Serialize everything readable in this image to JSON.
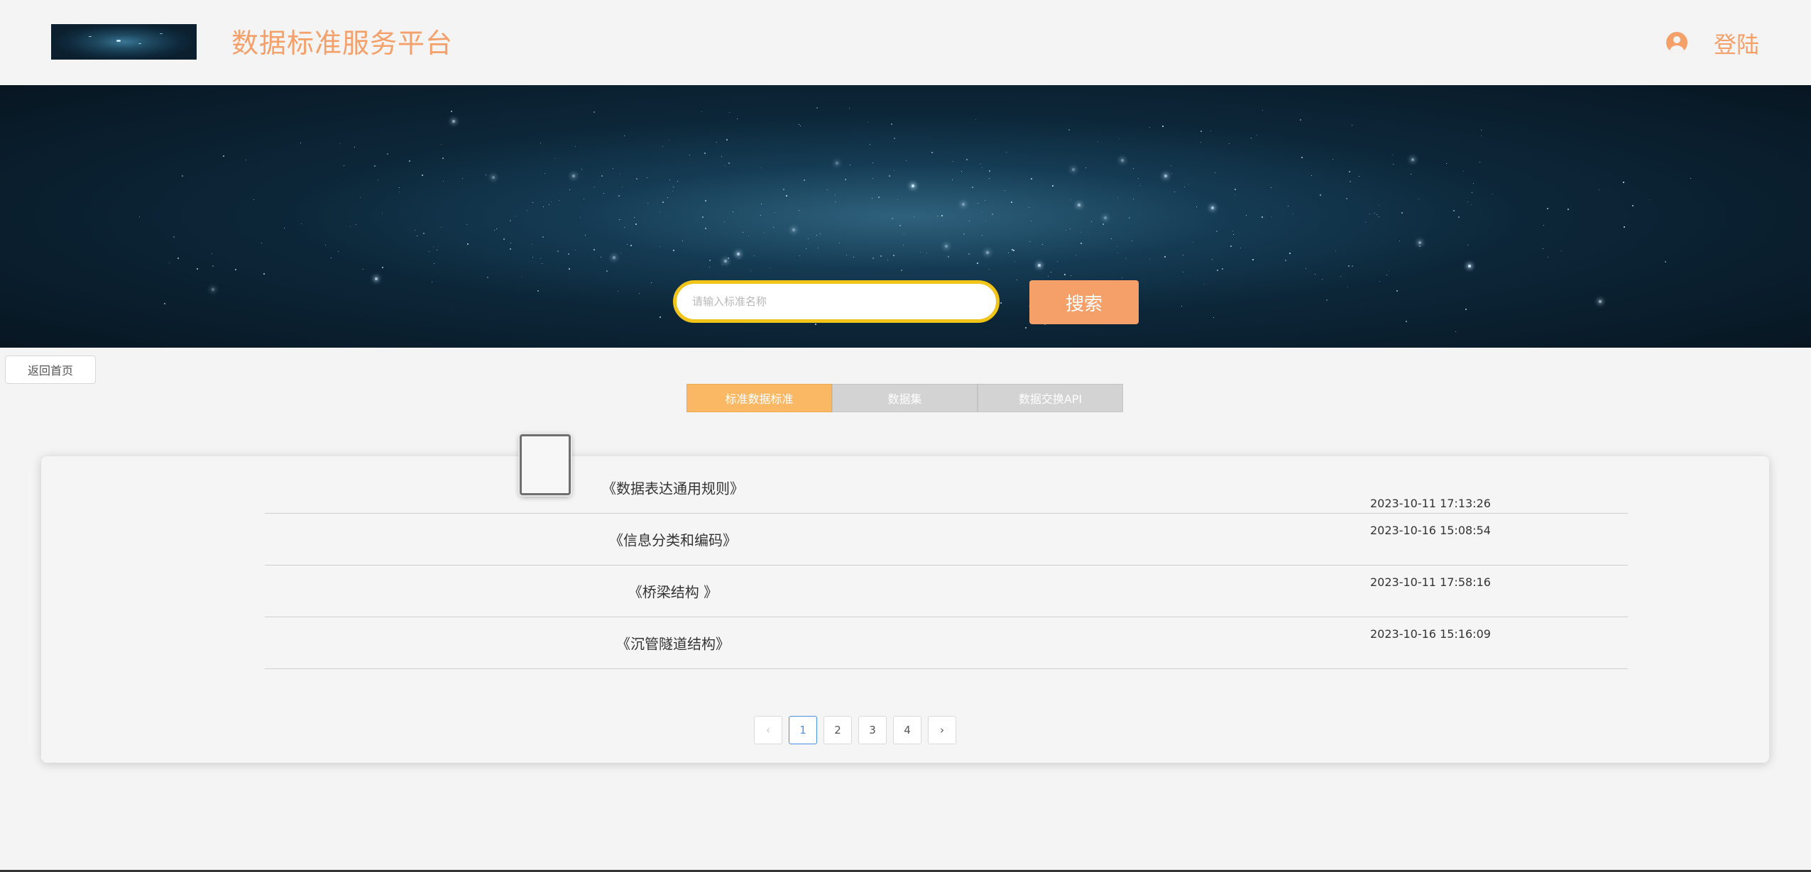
{
  "header": {
    "site_title": "数据标准服务平台",
    "login_label": "登陆",
    "user_icon": "user-circle-icon",
    "accent_color": "#f59f69"
  },
  "search": {
    "placeholder": "请输入标准名称",
    "button_label": "搜索"
  },
  "nav": {
    "back_label": "返回首页"
  },
  "tabs": [
    {
      "label": "标准数据标准",
      "active": true
    },
    {
      "label": "数据集",
      "active": false
    },
    {
      "label": "数据交换API",
      "active": false
    }
  ],
  "list": {
    "rows": [
      {
        "title": "《数据表达通用规则》",
        "date": "2023-10-11 17:13:26"
      },
      {
        "title": "《信息分类和编码》",
        "date": "2023-10-16 15:08:54"
      },
      {
        "title": "《桥梁结构 》",
        "date": "2023-10-11 17:58:16"
      },
      {
        "title": "《沉管隧道结构》",
        "date": "2023-10-16 15:16:09"
      }
    ]
  },
  "pagination": {
    "prev": "‹",
    "pages": [
      "1",
      "2",
      "3",
      "4"
    ],
    "current": "1",
    "next": "›"
  }
}
